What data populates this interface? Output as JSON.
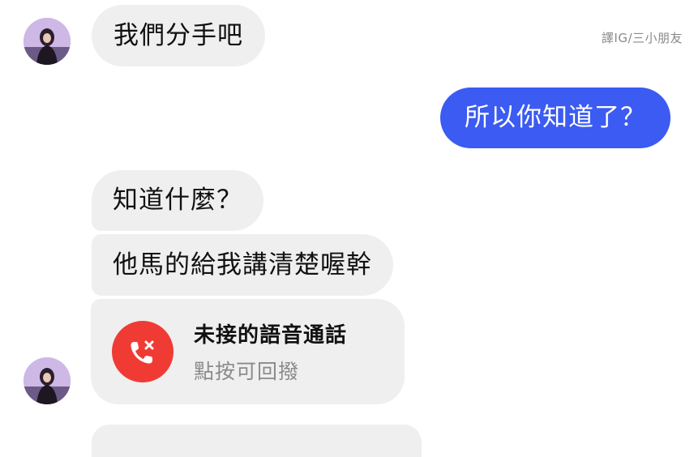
{
  "watermark": "譯IG/三小朋友",
  "messages": [
    {
      "text": "我們分手吧",
      "direction": "incoming"
    },
    {
      "text": "所以你知道了？",
      "direction": "outgoing"
    },
    {
      "text": "知道什麼？",
      "direction": "incoming"
    },
    {
      "text": "他馬的給我講清楚喔幹",
      "direction": "incoming"
    }
  ],
  "missed_call": {
    "title": "未接的語音通話",
    "subtitle": "點按可回撥",
    "icon": "missed-call-icon"
  },
  "colors": {
    "incoming_bubble": "#efefef",
    "outgoing_bubble": "#3b5bf2",
    "missed_call_red": "#f03b35"
  }
}
